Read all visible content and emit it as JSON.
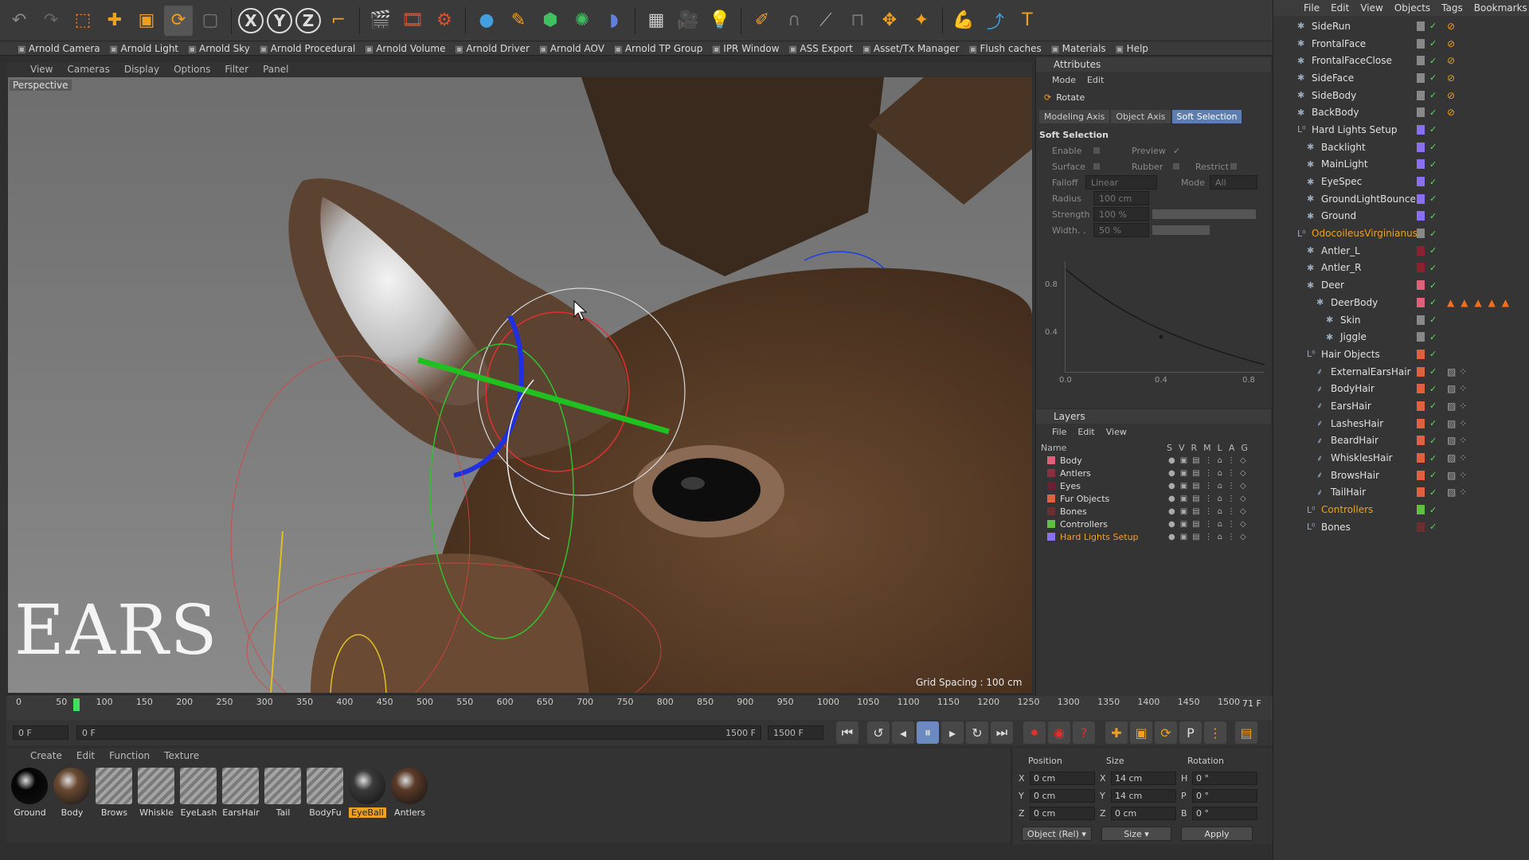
{
  "toolbar": {
    "axis_x": "X",
    "axis_y": "Y",
    "axis_z": "Z"
  },
  "arnold_bar": [
    "Arnold Camera",
    "Arnold Light",
    "Arnold Sky",
    "Arnold Procedural",
    "Arnold Volume",
    "Arnold Driver",
    "Arnold AOV",
    "Arnold TP Group",
    "IPR Window",
    "ASS Export",
    "Asset/Tx Manager",
    "Flush caches",
    "Materials",
    "Help"
  ],
  "viewport": {
    "menu": [
      "View",
      "Cameras",
      "Display",
      "Options",
      "Filter",
      "Panel"
    ],
    "label": "Perspective",
    "grid_spacing": "Grid Spacing : 100 cm",
    "overlay_text": "EARS"
  },
  "attributes": {
    "title": "Attributes",
    "menu": [
      "Mode",
      "Edit"
    ],
    "tool": "Rotate",
    "tabs": [
      "Modeling Axis",
      "Object Axis",
      "Soft Selection"
    ],
    "section": "Soft Selection",
    "props": {
      "enable": "Enable",
      "preview": "Preview",
      "surface": "Surface",
      "rubber": "Rubber",
      "restrict": "Restrict",
      "falloff": "Falloff",
      "falloff_value": "Linear",
      "mode": "Mode",
      "mode_value": "All",
      "radius": "Radius",
      "radius_value": "100 cm",
      "strength": "Strength",
      "strength_value": "100 %",
      "width": "Width. .",
      "width_value": "50 %"
    },
    "graph_y": [
      "0.8",
      "0.4",
      "0.0"
    ],
    "graph_x": [
      "0.4",
      "0.8"
    ]
  },
  "layers": {
    "title": "Layers",
    "menu": [
      "File",
      "Edit",
      "View"
    ],
    "col_name": "Name",
    "cols": [
      "S",
      "V",
      "R",
      "M",
      "L",
      "A",
      "G"
    ],
    "rows": [
      {
        "name": "Body",
        "color": "#e0607a"
      },
      {
        "name": "Antlers",
        "color": "#8a3040"
      },
      {
        "name": "Eyes",
        "color": "#6a2030"
      },
      {
        "name": "Fur Objects",
        "color": "#e06040"
      },
      {
        "name": "Bones",
        "color": "#6a3030"
      },
      {
        "name": "Controllers",
        "color": "#60c040"
      },
      {
        "name": "Hard Lights Setup",
        "color": "#8a70f0"
      }
    ]
  },
  "objects": {
    "menu": [
      "File",
      "Edit",
      "View",
      "Objects",
      "Tags",
      "Bookmarks"
    ],
    "rows": [
      {
        "name": "SideRun",
        "indent": 0,
        "color": "#888888"
      },
      {
        "name": "FrontalFace",
        "indent": 0,
        "color": "#888888"
      },
      {
        "name": "FrontalFaceClose",
        "indent": 0,
        "color": "#888888"
      },
      {
        "name": "SideFace",
        "indent": 0,
        "color": "#888888"
      },
      {
        "name": "SideBody",
        "indent": 0,
        "color": "#888888"
      },
      {
        "name": "BackBody",
        "indent": 0,
        "color": "#888888"
      },
      {
        "name": "Hard Lights Setup",
        "indent": 0,
        "color": "#8a70f0"
      },
      {
        "name": "Backlight",
        "indent": 1,
        "color": "#8a70f0"
      },
      {
        "name": "MainLight",
        "indent": 1,
        "color": "#8a70f0"
      },
      {
        "name": "EyeSpec",
        "indent": 1,
        "color": "#8a70f0"
      },
      {
        "name": "GroundLightBounce",
        "indent": 1,
        "color": "#8a70f0"
      },
      {
        "name": "Ground",
        "indent": 1,
        "color": "#8a70f0"
      },
      {
        "name": "OdocoileusVirginianus",
        "indent": 0,
        "color": "#888888",
        "highlight": true
      },
      {
        "name": "Antler_L",
        "indent": 1,
        "color": "#8a2030"
      },
      {
        "name": "Antler_R",
        "indent": 1,
        "color": "#8a2030"
      },
      {
        "name": "Deer",
        "indent": 1,
        "color": "#e0607a"
      },
      {
        "name": "DeerBody",
        "indent": 2,
        "color": "#e0607a"
      },
      {
        "name": "Skin",
        "indent": 3,
        "color": "#888888"
      },
      {
        "name": "Jiggle",
        "indent": 3,
        "color": "#888888"
      },
      {
        "name": "Hair Objects",
        "indent": 1,
        "color": "#e06040"
      },
      {
        "name": "ExternalEarsHair",
        "indent": 2,
        "color": "#e06040"
      },
      {
        "name": "BodyHair",
        "indent": 2,
        "color": "#e06040"
      },
      {
        "name": "EarsHair",
        "indent": 2,
        "color": "#e06040"
      },
      {
        "name": "LashesHair",
        "indent": 2,
        "color": "#e06040"
      },
      {
        "name": "BeardHair",
        "indent": 2,
        "color": "#e06040"
      },
      {
        "name": "WhisklesHair",
        "indent": 2,
        "color": "#e06040"
      },
      {
        "name": "BrowsHair",
        "indent": 2,
        "color": "#e06040"
      },
      {
        "name": "TailHair",
        "indent": 2,
        "color": "#e06040"
      },
      {
        "name": "Controllers",
        "indent": 1,
        "color": "#60c040",
        "highlight": true
      },
      {
        "name": "Bones",
        "indent": 1,
        "color": "#6a3030"
      }
    ]
  },
  "timeline": {
    "ticks": [
      "0",
      "50",
      "100",
      "150",
      "200",
      "250",
      "300",
      "350",
      "400",
      "450",
      "500",
      "550",
      "600",
      "650",
      "700",
      "750",
      "800",
      "850",
      "900",
      "950",
      "1000",
      "1050",
      "1100",
      "1150",
      "1200",
      "1250",
      "1300",
      "1350",
      "1400",
      "1450",
      "1500"
    ],
    "current_frame": "71 F",
    "start_field": "0 F",
    "range_start": "0 F",
    "range_end": "1500 F",
    "end_field": "1500 F"
  },
  "materials": {
    "menu": [
      "Create",
      "Edit",
      "Function",
      "Texture"
    ],
    "items": [
      {
        "name": "Ground",
        "color": "#050505"
      },
      {
        "name": "Body",
        "color": "#6a4a33"
      },
      {
        "name": "Brows",
        "color": "#9a9a9a"
      },
      {
        "name": "Whiskle",
        "color": "#9a9a9a"
      },
      {
        "name": "EyeLash",
        "color": "#9a9a9a"
      },
      {
        "name": "EarsHair",
        "color": "#9a9a9a"
      },
      {
        "name": "Tail",
        "color": "#9a9a9a"
      },
      {
        "name": "BodyFu",
        "color": "#9a9a9a"
      },
      {
        "name": "EyeBall",
        "color": "#3a3a3a",
        "selected": true
      },
      {
        "name": "Antlers",
        "color": "#5a3a28"
      }
    ]
  },
  "coords": {
    "headers": [
      "Position",
      "Size",
      "Rotation"
    ],
    "rows": [
      {
        "axis": "X",
        "pos": "0 cm",
        "saxis": "X",
        "size": "14 cm",
        "raxis": "H",
        "rot": "0 °"
      },
      {
        "axis": "Y",
        "pos": "0 cm",
        "saxis": "Y",
        "size": "14 cm",
        "raxis": "P",
        "rot": "0 °"
      },
      {
        "axis": "Z",
        "pos": "0 cm",
        "saxis": "Z",
        "size": "0 cm",
        "raxis": "B",
        "rot": "0 °"
      }
    ],
    "mode": "Object (Rel)",
    "size_mode": "Size",
    "apply": "Apply"
  }
}
